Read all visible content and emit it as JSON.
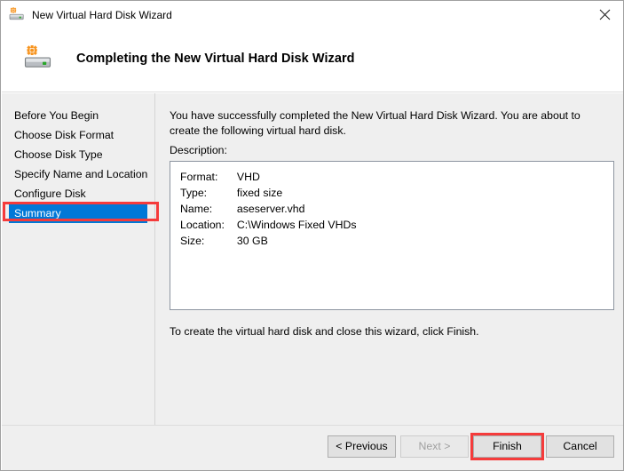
{
  "window": {
    "title": "New Virtual Hard Disk Wizard",
    "title_icon": "virtual-hard-disk-icon",
    "close_icon": "close-icon"
  },
  "header": {
    "icon": "virtual-hard-disk-icon-large",
    "title": "Completing the New Virtual Hard Disk Wizard"
  },
  "sidebar": {
    "items": [
      {
        "label": "Before You Begin",
        "selected": false
      },
      {
        "label": "Choose Disk Format",
        "selected": false
      },
      {
        "label": "Choose Disk Type",
        "selected": false
      },
      {
        "label": "Specify Name and Location",
        "selected": false
      },
      {
        "label": "Configure Disk",
        "selected": false
      },
      {
        "label": "Summary",
        "selected": true
      }
    ]
  },
  "main": {
    "intro_text": "You have successfully completed the New Virtual Hard Disk Wizard. You are about to create the following virtual hard disk.",
    "description_label": "Description:",
    "description_rows": [
      {
        "key": "Format:",
        "value": "VHD"
      },
      {
        "key": "Type:",
        "value": "fixed size"
      },
      {
        "key": "Name:",
        "value": "aseserver.vhd"
      },
      {
        "key": "Location:",
        "value": "C:\\Windows Fixed VHDs"
      },
      {
        "key": "Size:",
        "value": "30 GB"
      }
    ],
    "closing_text": "To create the virtual hard disk and close this wizard, click Finish."
  },
  "footer": {
    "previous_label": "< Previous",
    "next_label": "Next >",
    "finish_label": "Finish",
    "cancel_label": "Cancel",
    "next_disabled": true
  },
  "annotations": {
    "color": "#f53b3b",
    "targets": [
      "sidebar-item-summary",
      "finish-button"
    ]
  },
  "colors": {
    "selection_blue": "#0078d7",
    "body_grey": "#efefef",
    "button_face": "#e1e1e1",
    "icon_orange": "#f7941e"
  }
}
